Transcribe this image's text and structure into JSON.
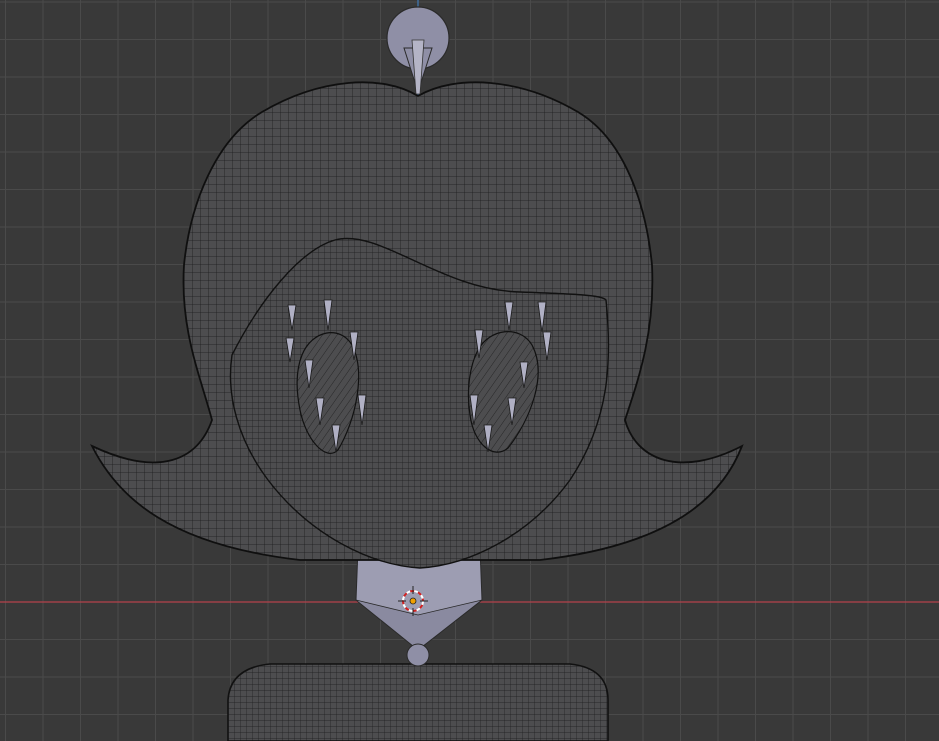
{
  "viewport": {
    "background_color": "#393939",
    "grid_minor_color": "#424242",
    "grid_major_color": "#4a4a4a",
    "x_axis_color": "#b5424b",
    "z_axis_color": "#3f79b8"
  },
  "mesh": {
    "wire_color": "#1c1c1c",
    "fill_color": "#4d4d4f",
    "selected_fill_color": "#9d9db2",
    "bone_color": "#8f8fa6"
  },
  "scene_objects": [
    {
      "name": "hair",
      "kind": "mesh"
    },
    {
      "name": "face",
      "kind": "mesh"
    },
    {
      "name": "left-eye",
      "kind": "mesh"
    },
    {
      "name": "right-eye",
      "kind": "mesh"
    },
    {
      "name": "neck",
      "kind": "mesh"
    },
    {
      "name": "torso",
      "kind": "mesh"
    },
    {
      "name": "head-bone",
      "kind": "armature"
    },
    {
      "name": "3d-cursor",
      "kind": "cursor"
    }
  ]
}
